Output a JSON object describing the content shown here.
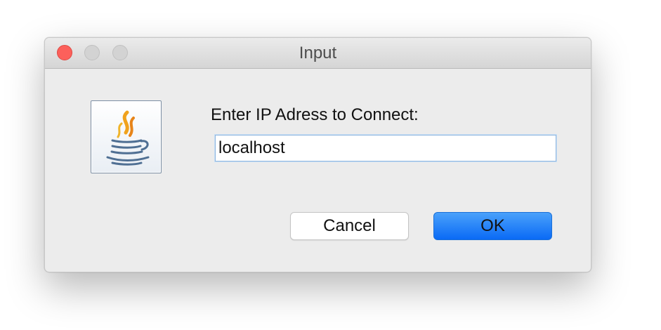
{
  "window": {
    "title": "Input"
  },
  "dialog": {
    "icon": "java-coffee-cup-icon",
    "prompt": "Enter IP Adress to Connect:",
    "input_value": "localhost"
  },
  "buttons": {
    "cancel_label": "Cancel",
    "ok_label": "OK"
  },
  "colors": {
    "close": "#fc605b",
    "inactive_traffic_light": "#d3d3d3",
    "ok_button": "#0a6af5",
    "dialog_background": "#ececec",
    "input_focus": "#8fb6de"
  }
}
